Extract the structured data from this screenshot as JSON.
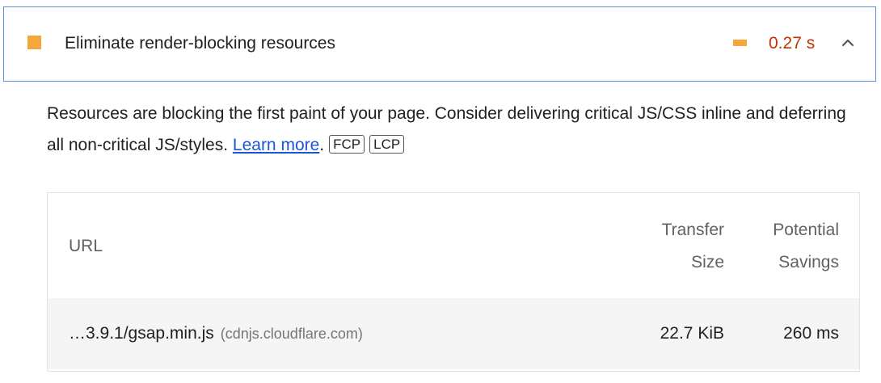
{
  "audit": {
    "title": "Eliminate render-blocking resources",
    "metric_value": "0.27 s",
    "status_color": "#f4a73a",
    "value_color": "#c33300",
    "chevron_icon": "chevron-up-icon",
    "description_text": "Resources are blocking the first paint of your page. Consider delivering critical JS/CSS inline and deferring all non-critical JS/styles. ",
    "learn_more": "Learn more",
    "period": ".",
    "chips": [
      "FCP",
      "LCP"
    ]
  },
  "table": {
    "headers": {
      "url": "URL",
      "transfer_line1": "Transfer",
      "transfer_line2": "Size",
      "savings_line1": "Potential",
      "savings_line2": "Savings"
    },
    "rows": [
      {
        "url": "…3.9.1/gsap.min.js",
        "origin": "(cdnjs.cloudflare.com)",
        "transfer_size": "22.7 KiB",
        "potential_savings": "260 ms"
      }
    ]
  }
}
